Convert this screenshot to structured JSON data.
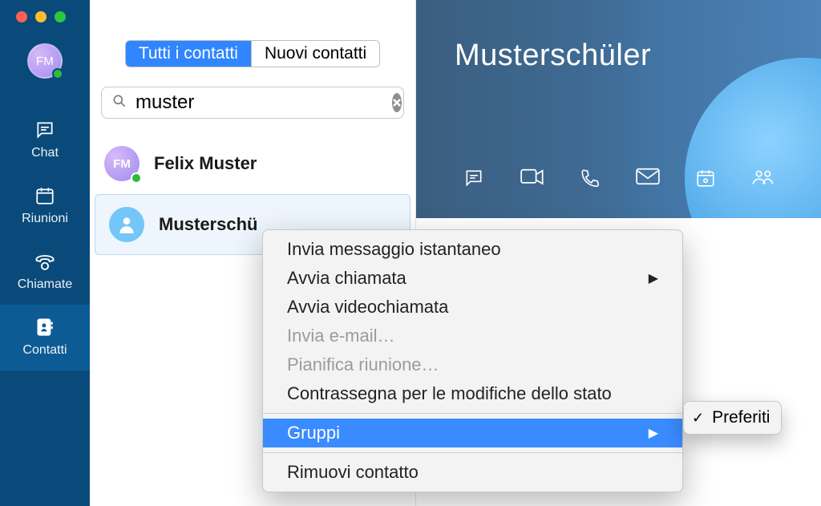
{
  "sidebar": {
    "avatar_initials": "FM",
    "items": [
      {
        "label": "Chat"
      },
      {
        "label": "Riunioni"
      },
      {
        "label": "Chiamate"
      },
      {
        "label": "Contatti"
      }
    ]
  },
  "segmented": {
    "all": "Tutti i contatti",
    "new": "Nuovi contatti"
  },
  "search": {
    "value": "muster"
  },
  "contacts": [
    {
      "initials": "FM",
      "name": "Felix Muster",
      "kind": "user"
    },
    {
      "initials": "",
      "name": "Musterschü",
      "kind": "generic"
    }
  ],
  "detail": {
    "title": "Musterschüler"
  },
  "context_menu": {
    "items": [
      {
        "label": "Invia messaggio istantaneo",
        "submenu": false,
        "enabled": true
      },
      {
        "label": "Avvia chiamata",
        "submenu": true,
        "enabled": true
      },
      {
        "label": "Avvia videochiamata",
        "submenu": false,
        "enabled": true
      },
      {
        "label": "Invia e-mail…",
        "submenu": false,
        "enabled": false
      },
      {
        "label": "Pianifica riunione…",
        "submenu": false,
        "enabled": false
      },
      {
        "label": "Contrassegna per le modifiche dello stato",
        "submenu": false,
        "enabled": true
      },
      {
        "label": "Gruppi",
        "submenu": true,
        "enabled": true,
        "highlighted": true
      },
      {
        "label": "Rimuovi contatto",
        "submenu": false,
        "enabled": true
      }
    ],
    "submenu": {
      "label": "Preferiti",
      "checked": true
    }
  }
}
